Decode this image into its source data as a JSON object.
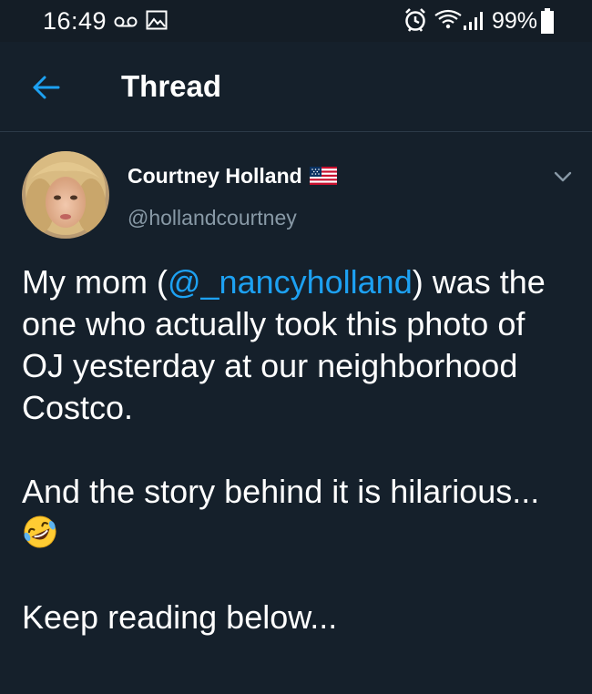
{
  "status_bar": {
    "time": "16:49",
    "battery": "99%",
    "icons": [
      "voicemail-icon",
      "gallery-icon",
      "alarm-icon",
      "wifi-icon",
      "signal-icon",
      "battery-icon"
    ]
  },
  "header": {
    "title": "Thread",
    "back_icon": "arrow-left-icon"
  },
  "tweet": {
    "author_name": "Courtney Holland",
    "author_flag": "us-flag-emoji",
    "handle": "@hollandcourtney",
    "paragraph1_prefix": "My mom (",
    "mention": "@_nancyholland",
    "paragraph1_suffix": ") was the one who actually took this photo of OJ yesterday at our neighborhood Costco.",
    "paragraph2": "And the story behind it is hilarious...",
    "paragraph2_emoji": "rolling-on-floor-laughing-emoji",
    "paragraph3": "Keep reading below..."
  },
  "colors": {
    "background": "#15202b",
    "status_bar": "#141d26",
    "accent": "#1da1f2",
    "secondary_text": "#8899a6",
    "divider": "#2c3a48"
  }
}
